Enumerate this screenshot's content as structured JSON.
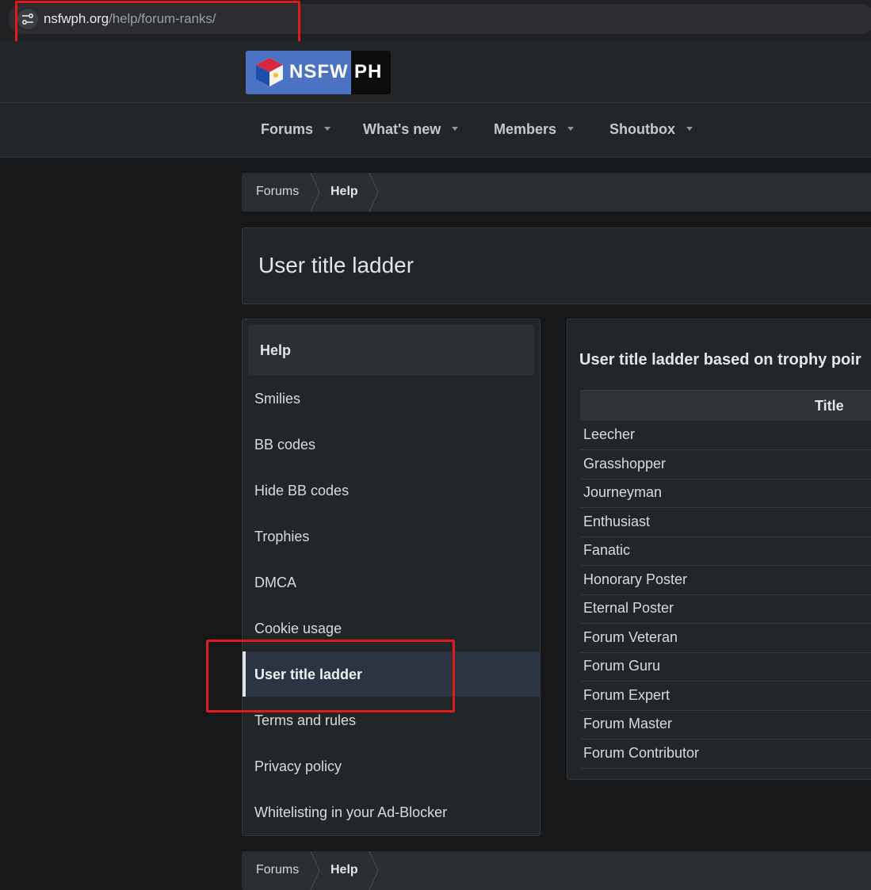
{
  "browser": {
    "url_host": "nsfwph.org",
    "url_path": "/help/forum-ranks/"
  },
  "logo": {
    "part1": "NSFW",
    "part2": "PH"
  },
  "nav": {
    "items": [
      {
        "label": "Forums"
      },
      {
        "label": "What's new"
      },
      {
        "label": "Members"
      },
      {
        "label": "Shoutbox"
      }
    ]
  },
  "breadcrumb": {
    "forums": "Forums",
    "help": "Help"
  },
  "page": {
    "title": "User title ladder"
  },
  "sidebar": {
    "heading": "Help",
    "items": [
      {
        "label": "Smilies"
      },
      {
        "label": "BB codes"
      },
      {
        "label": "Hide BB codes"
      },
      {
        "label": "Trophies"
      },
      {
        "label": "DMCA"
      },
      {
        "label": "Cookie usage"
      },
      {
        "label": "User title ladder"
      },
      {
        "label": "Terms and rules"
      },
      {
        "label": "Privacy policy"
      },
      {
        "label": "Whitelisting in your Ad-Blocker"
      }
    ],
    "active_index": 6
  },
  "main": {
    "heading": "User title ladder based on trophy poir",
    "table": {
      "header": "Title",
      "rows": [
        "Leecher",
        "Grasshopper",
        "Journeyman",
        "Enthusiast",
        "Fanatic",
        "Honorary Poster",
        "Eternal Poster",
        "Forum Veteran",
        "Forum Guru",
        "Forum Expert",
        "Forum Master",
        "Forum Contributor"
      ]
    }
  },
  "colors": {
    "background": "#151718",
    "panel": "#222628",
    "active_item": "#2b3442",
    "annotation": "#e01b1b",
    "logo_blue": "#4b72c3"
  }
}
